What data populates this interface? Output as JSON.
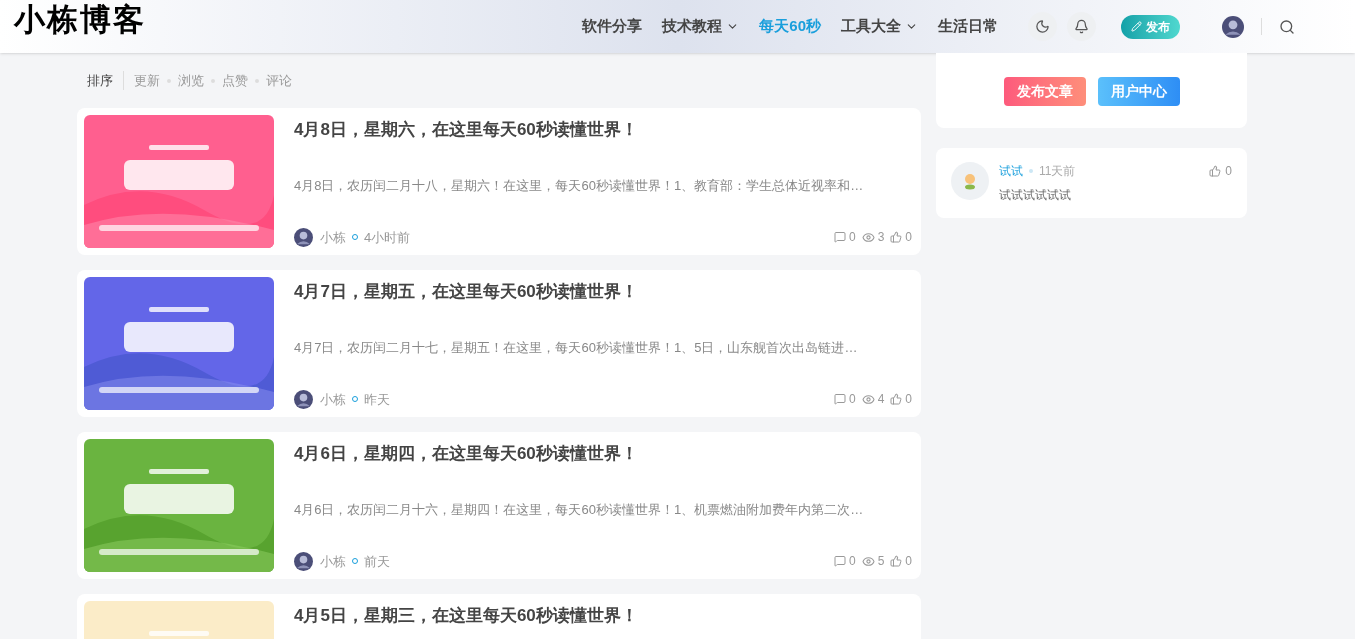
{
  "header": {
    "logo": "小栋博客",
    "nav": [
      {
        "label": "软件分享",
        "selected": false,
        "dropdown": false
      },
      {
        "label": "技术教程",
        "selected": false,
        "dropdown": true
      },
      {
        "label": "每天60秒",
        "selected": true,
        "dropdown": false
      },
      {
        "label": "工具大全",
        "selected": false,
        "dropdown": true
      },
      {
        "label": "生活日常",
        "selected": false,
        "dropdown": false
      }
    ],
    "publish_button": "发布"
  },
  "sort_bar": {
    "label": "排序",
    "options": [
      "更新",
      "浏览",
      "点赞",
      "评论"
    ]
  },
  "articles": [
    {
      "title": "4月8日，星期六，在这里每天60秒读懂世界！",
      "excerpt": "4月8日，农历闰二月十八，星期六！在这里，每天60秒读懂世界！1、教育部：学生总体近视率和…",
      "author": "小栋",
      "time": "4小时前",
      "comments": "0",
      "views": "3",
      "likes": "0"
    },
    {
      "title": "4月7日，星期五，在这里每天60秒读懂世界！",
      "excerpt": "4月7日，农历闰二月十七，星期五！在这里，每天60秒读懂世界！1、5日，山东舰首次出岛链进…",
      "author": "小栋",
      "time": "昨天",
      "comments": "0",
      "views": "4",
      "likes": "0"
    },
    {
      "title": "4月6日，星期四，在这里每天60秒读懂世界！",
      "excerpt": "4月6日，农历闰二月十六，星期四！在这里，每天60秒读懂世界！1、机票燃油附加费年内第二次…",
      "author": "小栋",
      "time": "前天",
      "comments": "0",
      "views": "5",
      "likes": "0"
    },
    {
      "title": "4月5日，星期三，在这里每天60秒读懂世界！"
    }
  ],
  "sidebar": {
    "buttons": [
      "发布文章",
      "用户中心"
    ],
    "comments": [
      {
        "user": "试试",
        "time": "11天前",
        "likes": "0",
        "text": "试试试试试试"
      }
    ]
  }
}
